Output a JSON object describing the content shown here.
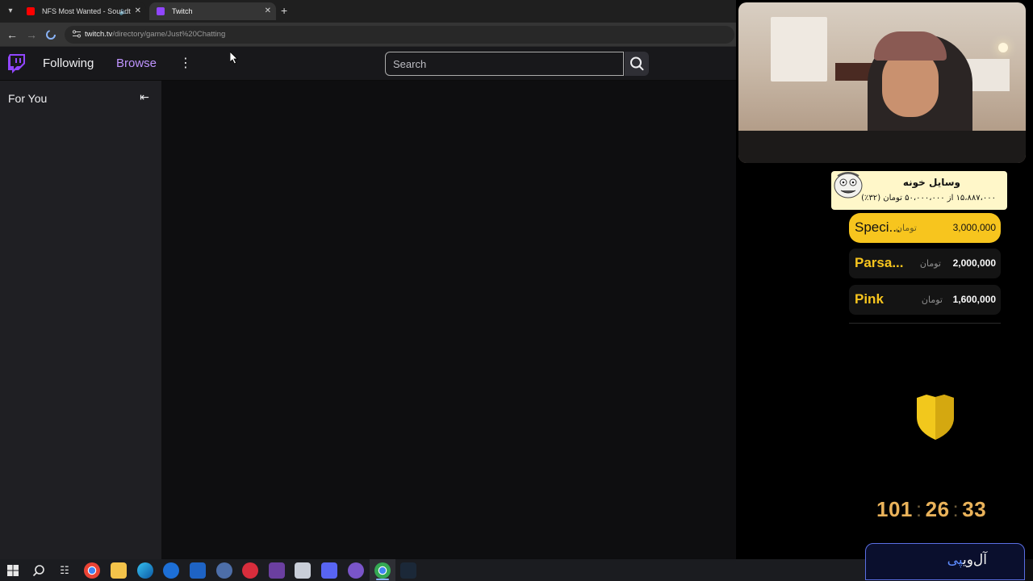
{
  "browser": {
    "tabs": [
      {
        "title": "NFS Most Wanted - Soundt",
        "favicon_color": "#ff0000",
        "has_audio": true,
        "active": false
      },
      {
        "title": "Twitch",
        "favicon_color": "#9146ff",
        "has_audio": false,
        "active": true
      }
    ],
    "url_host": "twitch.tv",
    "url_path": "/directory/game/Just%20Chatting"
  },
  "twitch": {
    "nav_following": "Following",
    "nav_browse": "Browse",
    "search_placeholder": "Search",
    "sidebar_title": "For You",
    "accent_color": "#9146ff",
    "browse_color": "#bf94ff"
  },
  "overlay": {
    "goal_title": "وسایل خونه",
    "goal_progress": "۱۵،۸۸۷،۰۰۰ از ۵۰،۰۰۰،۰۰۰ تومان (۳۲٪)",
    "currency": "تومان",
    "donors": [
      {
        "name": "Speci...",
        "amount": "3,000,000"
      },
      {
        "name": "Parsa...",
        "amount": "2,000,000"
      },
      {
        "name": "Pink",
        "amount": "1,600,000"
      }
    ],
    "timer": {
      "hours": "101",
      "minutes": "26",
      "seconds": "33"
    },
    "brand": {
      "main": "آل‌وی",
      "accent": "پی"
    },
    "gold_color": "#f7c51e"
  }
}
